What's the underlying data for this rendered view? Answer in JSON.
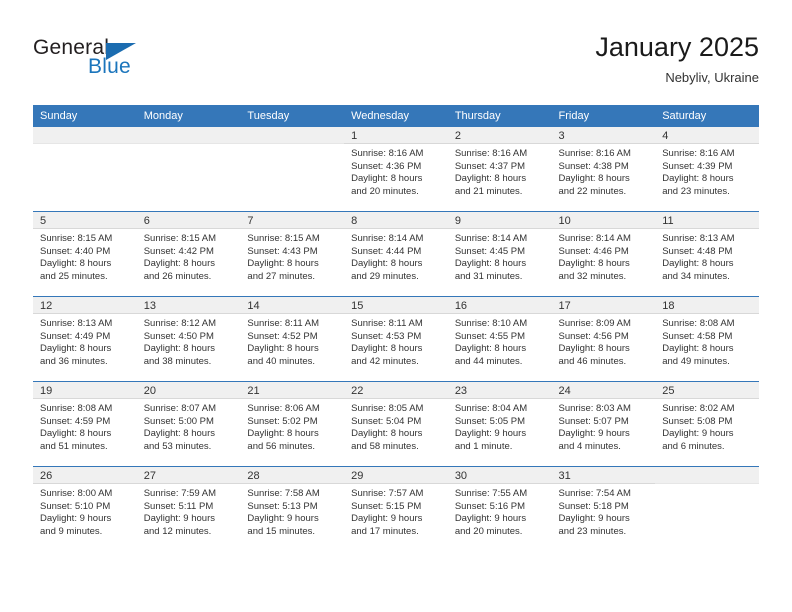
{
  "brand": {
    "name_dark": "General",
    "name_blue": "Blue",
    "accent_color": "#1b75bc",
    "triangle_color": "#1b6cb0"
  },
  "header": {
    "title": "January 2025",
    "subtitle": "Nebyliv, Ukraine"
  },
  "theme": {
    "header_row_bg": "#3577b9",
    "daynum_band_bg": "#f0f0f0",
    "text_color": "#333333"
  },
  "weekday_headers": [
    "Sunday",
    "Monday",
    "Tuesday",
    "Wednesday",
    "Thursday",
    "Friday",
    "Saturday"
  ],
  "weeks": [
    [
      {
        "day": "",
        "sunrise": "",
        "sunset": "",
        "daylight_line1": "",
        "daylight_line2": ""
      },
      {
        "day": "",
        "sunrise": "",
        "sunset": "",
        "daylight_line1": "",
        "daylight_line2": ""
      },
      {
        "day": "",
        "sunrise": "",
        "sunset": "",
        "daylight_line1": "",
        "daylight_line2": ""
      },
      {
        "day": "1",
        "sunrise": "Sunrise: 8:16 AM",
        "sunset": "Sunset: 4:36 PM",
        "daylight_line1": "Daylight: 8 hours",
        "daylight_line2": "and 20 minutes."
      },
      {
        "day": "2",
        "sunrise": "Sunrise: 8:16 AM",
        "sunset": "Sunset: 4:37 PM",
        "daylight_line1": "Daylight: 8 hours",
        "daylight_line2": "and 21 minutes."
      },
      {
        "day": "3",
        "sunrise": "Sunrise: 8:16 AM",
        "sunset": "Sunset: 4:38 PM",
        "daylight_line1": "Daylight: 8 hours",
        "daylight_line2": "and 22 minutes."
      },
      {
        "day": "4",
        "sunrise": "Sunrise: 8:16 AM",
        "sunset": "Sunset: 4:39 PM",
        "daylight_line1": "Daylight: 8 hours",
        "daylight_line2": "and 23 minutes."
      }
    ],
    [
      {
        "day": "5",
        "sunrise": "Sunrise: 8:15 AM",
        "sunset": "Sunset: 4:40 PM",
        "daylight_line1": "Daylight: 8 hours",
        "daylight_line2": "and 25 minutes."
      },
      {
        "day": "6",
        "sunrise": "Sunrise: 8:15 AM",
        "sunset": "Sunset: 4:42 PM",
        "daylight_line1": "Daylight: 8 hours",
        "daylight_line2": "and 26 minutes."
      },
      {
        "day": "7",
        "sunrise": "Sunrise: 8:15 AM",
        "sunset": "Sunset: 4:43 PM",
        "daylight_line1": "Daylight: 8 hours",
        "daylight_line2": "and 27 minutes."
      },
      {
        "day": "8",
        "sunrise": "Sunrise: 8:14 AM",
        "sunset": "Sunset: 4:44 PM",
        "daylight_line1": "Daylight: 8 hours",
        "daylight_line2": "and 29 minutes."
      },
      {
        "day": "9",
        "sunrise": "Sunrise: 8:14 AM",
        "sunset": "Sunset: 4:45 PM",
        "daylight_line1": "Daylight: 8 hours",
        "daylight_line2": "and 31 minutes."
      },
      {
        "day": "10",
        "sunrise": "Sunrise: 8:14 AM",
        "sunset": "Sunset: 4:46 PM",
        "daylight_line1": "Daylight: 8 hours",
        "daylight_line2": "and 32 minutes."
      },
      {
        "day": "11",
        "sunrise": "Sunrise: 8:13 AM",
        "sunset": "Sunset: 4:48 PM",
        "daylight_line1": "Daylight: 8 hours",
        "daylight_line2": "and 34 minutes."
      }
    ],
    [
      {
        "day": "12",
        "sunrise": "Sunrise: 8:13 AM",
        "sunset": "Sunset: 4:49 PM",
        "daylight_line1": "Daylight: 8 hours",
        "daylight_line2": "and 36 minutes."
      },
      {
        "day": "13",
        "sunrise": "Sunrise: 8:12 AM",
        "sunset": "Sunset: 4:50 PM",
        "daylight_line1": "Daylight: 8 hours",
        "daylight_line2": "and 38 minutes."
      },
      {
        "day": "14",
        "sunrise": "Sunrise: 8:11 AM",
        "sunset": "Sunset: 4:52 PM",
        "daylight_line1": "Daylight: 8 hours",
        "daylight_line2": "and 40 minutes."
      },
      {
        "day": "15",
        "sunrise": "Sunrise: 8:11 AM",
        "sunset": "Sunset: 4:53 PM",
        "daylight_line1": "Daylight: 8 hours",
        "daylight_line2": "and 42 minutes."
      },
      {
        "day": "16",
        "sunrise": "Sunrise: 8:10 AM",
        "sunset": "Sunset: 4:55 PM",
        "daylight_line1": "Daylight: 8 hours",
        "daylight_line2": "and 44 minutes."
      },
      {
        "day": "17",
        "sunrise": "Sunrise: 8:09 AM",
        "sunset": "Sunset: 4:56 PM",
        "daylight_line1": "Daylight: 8 hours",
        "daylight_line2": "and 46 minutes."
      },
      {
        "day": "18",
        "sunrise": "Sunrise: 8:08 AM",
        "sunset": "Sunset: 4:58 PM",
        "daylight_line1": "Daylight: 8 hours",
        "daylight_line2": "and 49 minutes."
      }
    ],
    [
      {
        "day": "19",
        "sunrise": "Sunrise: 8:08 AM",
        "sunset": "Sunset: 4:59 PM",
        "daylight_line1": "Daylight: 8 hours",
        "daylight_line2": "and 51 minutes."
      },
      {
        "day": "20",
        "sunrise": "Sunrise: 8:07 AM",
        "sunset": "Sunset: 5:00 PM",
        "daylight_line1": "Daylight: 8 hours",
        "daylight_line2": "and 53 minutes."
      },
      {
        "day": "21",
        "sunrise": "Sunrise: 8:06 AM",
        "sunset": "Sunset: 5:02 PM",
        "daylight_line1": "Daylight: 8 hours",
        "daylight_line2": "and 56 minutes."
      },
      {
        "day": "22",
        "sunrise": "Sunrise: 8:05 AM",
        "sunset": "Sunset: 5:04 PM",
        "daylight_line1": "Daylight: 8 hours",
        "daylight_line2": "and 58 minutes."
      },
      {
        "day": "23",
        "sunrise": "Sunrise: 8:04 AM",
        "sunset": "Sunset: 5:05 PM",
        "daylight_line1": "Daylight: 9 hours",
        "daylight_line2": "and 1 minute."
      },
      {
        "day": "24",
        "sunrise": "Sunrise: 8:03 AM",
        "sunset": "Sunset: 5:07 PM",
        "daylight_line1": "Daylight: 9 hours",
        "daylight_line2": "and 4 minutes."
      },
      {
        "day": "25",
        "sunrise": "Sunrise: 8:02 AM",
        "sunset": "Sunset: 5:08 PM",
        "daylight_line1": "Daylight: 9 hours",
        "daylight_line2": "and 6 minutes."
      }
    ],
    [
      {
        "day": "26",
        "sunrise": "Sunrise: 8:00 AM",
        "sunset": "Sunset: 5:10 PM",
        "daylight_line1": "Daylight: 9 hours",
        "daylight_line2": "and 9 minutes."
      },
      {
        "day": "27",
        "sunrise": "Sunrise: 7:59 AM",
        "sunset": "Sunset: 5:11 PM",
        "daylight_line1": "Daylight: 9 hours",
        "daylight_line2": "and 12 minutes."
      },
      {
        "day": "28",
        "sunrise": "Sunrise: 7:58 AM",
        "sunset": "Sunset: 5:13 PM",
        "daylight_line1": "Daylight: 9 hours",
        "daylight_line2": "and 15 minutes."
      },
      {
        "day": "29",
        "sunrise": "Sunrise: 7:57 AM",
        "sunset": "Sunset: 5:15 PM",
        "daylight_line1": "Daylight: 9 hours",
        "daylight_line2": "and 17 minutes."
      },
      {
        "day": "30",
        "sunrise": "Sunrise: 7:55 AM",
        "sunset": "Sunset: 5:16 PM",
        "daylight_line1": "Daylight: 9 hours",
        "daylight_line2": "and 20 minutes."
      },
      {
        "day": "31",
        "sunrise": "Sunrise: 7:54 AM",
        "sunset": "Sunset: 5:18 PM",
        "daylight_line1": "Daylight: 9 hours",
        "daylight_line2": "and 23 minutes."
      },
      {
        "day": "",
        "sunrise": "",
        "sunset": "",
        "daylight_line1": "",
        "daylight_line2": ""
      }
    ]
  ]
}
